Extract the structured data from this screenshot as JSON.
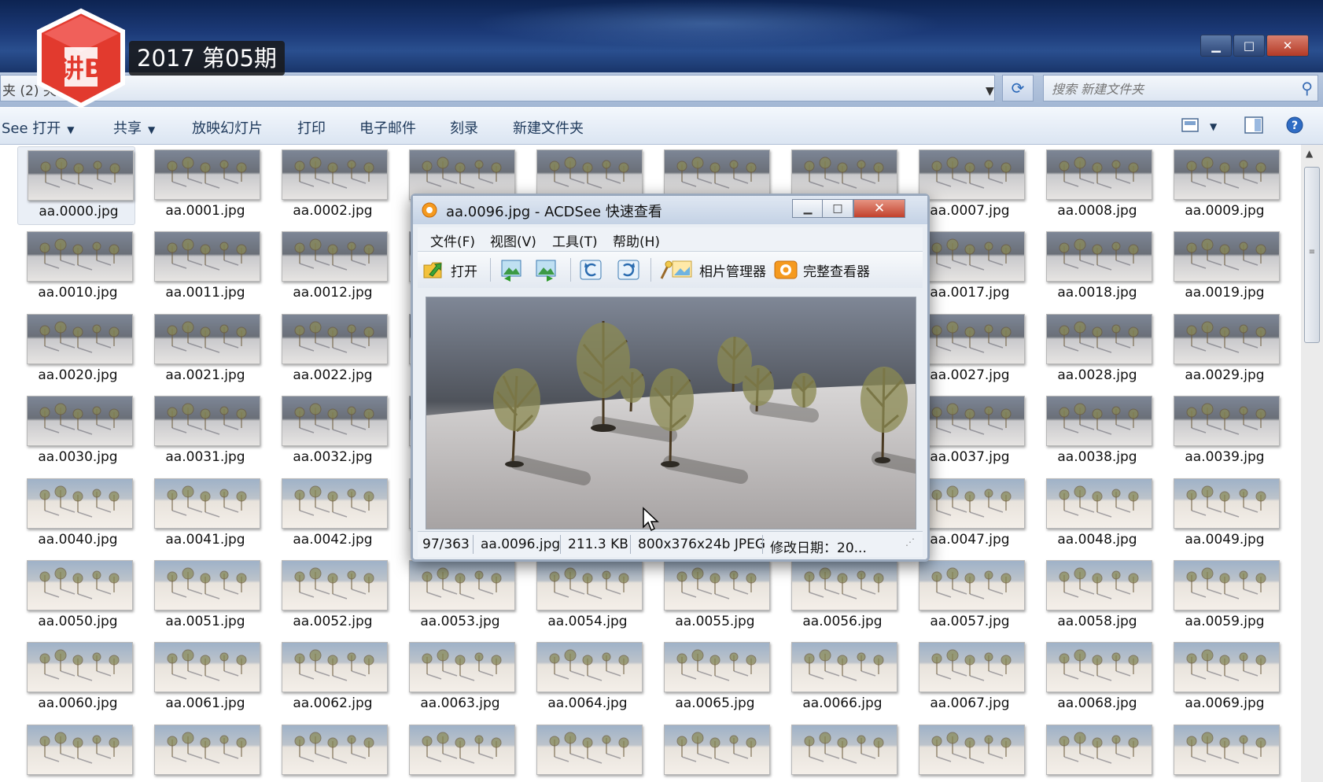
{
  "overlay": {
    "logo_text": "讲B",
    "issue": "2017 第05期"
  },
  "window": {
    "controls": {
      "minimize": "▁",
      "maximize": "□",
      "close": "✕"
    }
  },
  "address": {
    "path": "夹 (2)       夹",
    "search_placeholder": "搜索 新建文件夹"
  },
  "toolbar": {
    "open": "See 打开",
    "share": "共享",
    "slideshow": "放映幻灯片",
    "print": "打印",
    "email": "电子邮件",
    "burn": "刻录",
    "new_folder": "新建文件夹"
  },
  "files": [
    "aa.0000.jpg",
    "aa.0001.jpg",
    "aa.0002.jpg",
    "",
    "",
    "",
    "",
    "aa.0007.jpg",
    "aa.0008.jpg",
    "aa.0009.jpg",
    "aa.0010.jpg",
    "aa.0011.jpg",
    "aa.0012.jpg",
    "",
    "",
    "",
    "",
    "aa.0017.jpg",
    "aa.0018.jpg",
    "aa.0019.jpg",
    "aa.0020.jpg",
    "aa.0021.jpg",
    "aa.0022.jpg",
    "",
    "",
    "",
    "",
    "aa.0027.jpg",
    "aa.0028.jpg",
    "aa.0029.jpg",
    "aa.0030.jpg",
    "aa.0031.jpg",
    "aa.0032.jpg",
    "",
    "",
    "",
    "",
    "aa.0037.jpg",
    "aa.0038.jpg",
    "aa.0039.jpg",
    "aa.0040.jpg",
    "aa.0041.jpg",
    "aa.0042.jpg",
    "",
    "",
    "",
    "",
    "aa.0047.jpg",
    "aa.0048.jpg",
    "aa.0049.jpg",
    "aa.0050.jpg",
    "aa.0051.jpg",
    "aa.0052.jpg",
    "aa.0053.jpg",
    "aa.0054.jpg",
    "aa.0055.jpg",
    "aa.0056.jpg",
    "aa.0057.jpg",
    "aa.0058.jpg",
    "aa.0059.jpg",
    "aa.0060.jpg",
    "aa.0061.jpg",
    "aa.0062.jpg",
    "aa.0063.jpg",
    "aa.0064.jpg",
    "aa.0065.jpg",
    "aa.0066.jpg",
    "aa.0067.jpg",
    "aa.0068.jpg",
    "aa.0069.jpg",
    "",
    "",
    "",
    "",
    "",
    "",
    "",
    "",
    "",
    ""
  ],
  "viewer": {
    "title": "aa.0096.jpg - ACDSee 快速查看",
    "menu": {
      "file": "文件(F)",
      "view": "视图(V)",
      "tools": "工具(T)",
      "help": "帮助(H)"
    },
    "toolbar": {
      "open": "打开",
      "photo_manager": "相片管理器",
      "full_viewer": "完整查看器"
    },
    "status": {
      "position": "97/363",
      "filename": "aa.0096.jpg",
      "size": "211.3 KB",
      "dimensions": "800x376x24b JPEG",
      "modified": "修改日期：20..."
    }
  },
  "colors": {
    "accent": "#1e395b",
    "close_red": "#c2412c"
  }
}
